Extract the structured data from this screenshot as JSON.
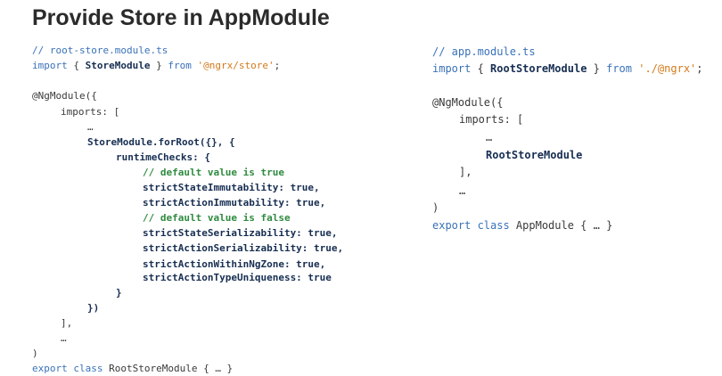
{
  "slide": {
    "title": "Provide Store in AppModule"
  },
  "left_code": {
    "comment": "// root-store.module.ts",
    "import_kw": "import",
    "import_open": "{ ",
    "import_name": "StoreModule",
    "import_close": " }",
    "from_kw": "from",
    "import_path": "'@ngrx/store'",
    "import_end": ";",
    "ngmodule": "@NgModule({",
    "imports": "imports: [",
    "ellipsis1": "…",
    "forroot": "StoreModule.forRoot({}, {",
    "runtime": "runtimeChecks: {",
    "comment_true": "// default value is true",
    "state_immut": "strictStateImmutability: true,",
    "action_immut": "strictActionImmutability: true,",
    "comment_false": "// default value is false",
    "state_serial": "strictStateSerializability: true,",
    "action_serial": "strictActionSerializability: true,",
    "ngzone": "strictActionWithinNgZone: true,",
    "type_unique": "strictActionTypeUniqueness: true",
    "close_brace": "}",
    "close_paren": "})",
    "close_bracket": "],",
    "ellipsis2": "…",
    "close_decorator": ")",
    "export_kw": "export class",
    "export_rest": " RootStoreModule { … }"
  },
  "right_code": {
    "comment": "// app.module.ts",
    "import_kw": "import",
    "import_open": "{ ",
    "import_name": "RootStoreModule",
    "import_close": " }",
    "from_kw": "from",
    "import_path": "'./@ngrx'",
    "import_end": ";",
    "ngmodule": "@NgModule({",
    "imports": "imports: [",
    "ellipsis1": "…",
    "root_store": "RootStoreModule",
    "close_bracket": "],",
    "ellipsis2": "…",
    "close_decorator": ")",
    "export_kw": "export class",
    "export_rest": " AppModule { … }"
  },
  "colors": {
    "keyword": "#3a72b8",
    "green_comment": "#2e8b3e",
    "string": "#d47a1a",
    "bold_identifier": "#172e52",
    "title": "#2b2b2b"
  }
}
